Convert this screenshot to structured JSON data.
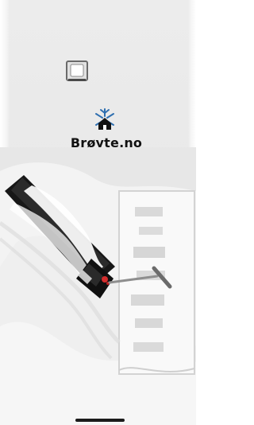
{
  "app": {
    "brand_name": "Brøyte.no"
  },
  "icons": {
    "logo": "snowflake-house-icon"
  },
  "colors": {
    "background": "#E9E9E9",
    "logo_accent": "#2F6FB0",
    "text": "#111111"
  }
}
